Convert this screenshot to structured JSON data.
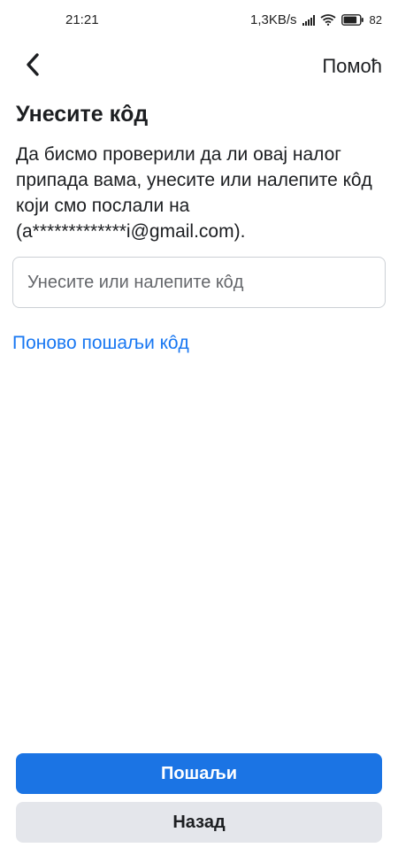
{
  "status_bar": {
    "time": "21:21",
    "network_speed": "1,3KB/s",
    "battery_percent": "82",
    "icons": [
      "signal-icon",
      "wifi-icon",
      "battery-icon"
    ]
  },
  "header": {
    "back_icon": "chevron-left-icon",
    "help_label": "Помоћ"
  },
  "main": {
    "title": "Унесите кôд",
    "description": "Да бисмо проверили да ли овај налог припада вама, унесите или налепите кôд који смо послали на (a*************i@gmail.com).",
    "code_input": {
      "value": "",
      "placeholder": "Унесите или налепите кôд"
    },
    "resend_label": "Поново пошаљи кôд"
  },
  "footer": {
    "send_label": "Пошаљи",
    "back_label": "Назад"
  },
  "colors": {
    "primary": "#1b74e4",
    "link": "#1877f2",
    "secondary_button": "#e4e6eb",
    "text": "#1c1e21"
  }
}
